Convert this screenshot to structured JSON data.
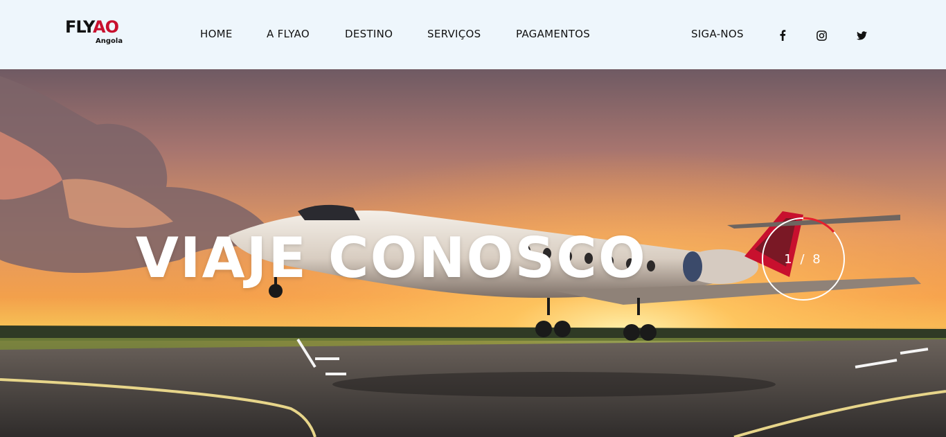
{
  "brand": {
    "logo_main": "FLY",
    "logo_accent": "AO",
    "logo_sub": "Angola",
    "accent_color": "#c8102e",
    "secondary_color": "#e0a100"
  },
  "nav": {
    "items": [
      {
        "label": "HOME"
      },
      {
        "label": "A FLYAO"
      },
      {
        "label": "DESTINO"
      },
      {
        "label": "SERVIÇOS"
      },
      {
        "label": "PAGAMENTOS"
      }
    ],
    "follow_label": "SIGA-NOS",
    "social": [
      {
        "icon": "facebook-icon"
      },
      {
        "icon": "instagram-icon"
      },
      {
        "icon": "twitter-icon"
      }
    ]
  },
  "hero": {
    "title": "VIAJE CONOSCO",
    "slide_counter": "1 / 8",
    "slide_current": 1,
    "slide_total": 8
  }
}
